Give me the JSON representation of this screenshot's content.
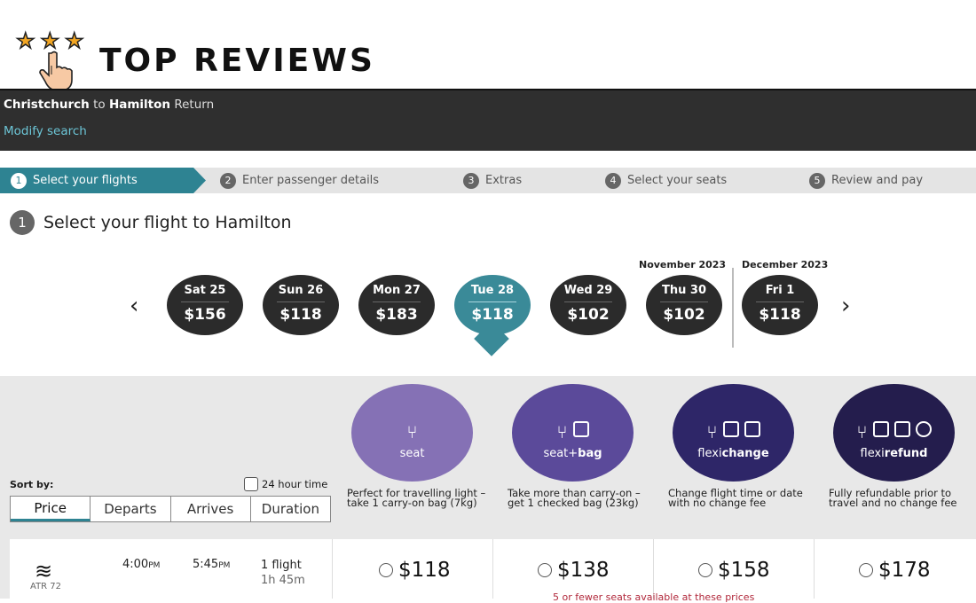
{
  "logo": {
    "text": "TOP REVIEWS"
  },
  "header": {
    "origin": "Christchurch",
    "connector": "to",
    "destination": "Hamilton",
    "trip_type": "Return",
    "modify_label": "Modify search"
  },
  "steps": [
    {
      "num": "1",
      "label": "Select your flights"
    },
    {
      "num": "2",
      "label": "Enter passenger details"
    },
    {
      "num": "3",
      "label": "Extras"
    },
    {
      "num": "4",
      "label": "Select your seats"
    },
    {
      "num": "5",
      "label": "Review and pay"
    }
  ],
  "section": {
    "num": "1",
    "title": "Select your flight to Hamilton"
  },
  "months": {
    "november": "November 2023",
    "december": "December 2023"
  },
  "dates": [
    {
      "day": "Sat 25",
      "price": "$156"
    },
    {
      "day": "Sun 26",
      "price": "$118"
    },
    {
      "day": "Mon 27",
      "price": "$183"
    },
    {
      "day": "Tue 28",
      "price": "$118"
    },
    {
      "day": "Wed 29",
      "price": "$102"
    },
    {
      "day": "Thu 30",
      "price": "$102"
    },
    {
      "day": "Fri 1",
      "price": "$118"
    }
  ],
  "fares": [
    {
      "name_pre": "seat",
      "name_bold": "",
      "color": "#8571b5",
      "desc": "Perfect for travelling light – take 1 carry-on bag (7kg)"
    },
    {
      "name_pre": "seat+",
      "name_bold": "bag",
      "color": "#5b4a9a",
      "desc": "Take more than carry-on – get 1 checked bag (23kg)"
    },
    {
      "name_pre": "flexi",
      "name_bold": "change",
      "color": "#2e2668",
      "desc": "Change flight time or date with no change fee"
    },
    {
      "name_pre": "flexi",
      "name_bold": "refund",
      "color": "#241d4d",
      "desc": "Fully refundable prior to travel and no change fee"
    }
  ],
  "sort": {
    "label": "Sort by:",
    "toggle_label": "24 hour time",
    "tabs": [
      "Price",
      "Departs",
      "Arrives",
      "Duration"
    ]
  },
  "flight": {
    "aircraft": "ATR 72",
    "depart": "4:00",
    "depart_suffix": "PM",
    "arrive": "5:45",
    "arrive_suffix": "PM",
    "stops": "1 flight",
    "duration": "1h 45m",
    "prices": [
      "$118",
      "$138",
      "$158",
      "$178"
    ],
    "warning": "5 or fewer seats available at these prices"
  },
  "colors": {
    "accent": "#2e8392",
    "header_bg": "#2f2f2f",
    "link": "#6cc5d6"
  }
}
